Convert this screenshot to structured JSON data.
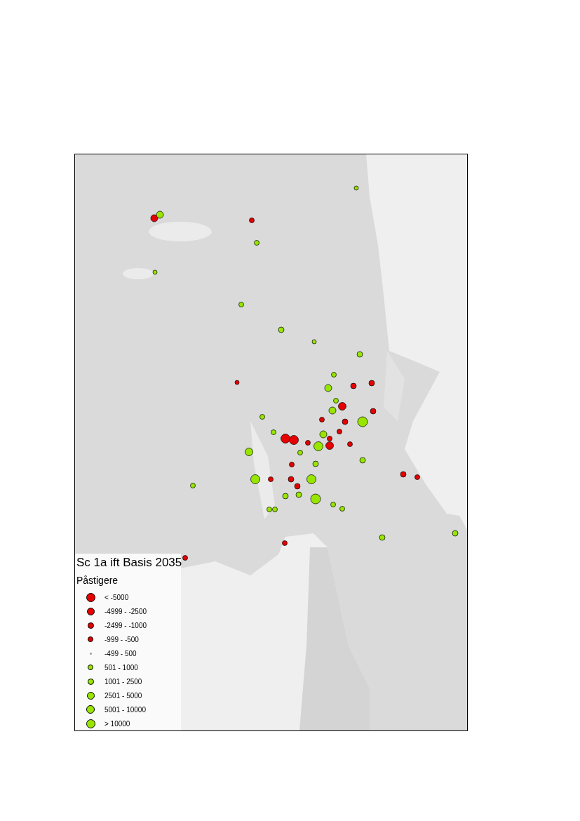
{
  "legend": {
    "title": "Sc 1a ift Basis 2035",
    "subtitle": "Påstigere",
    "items": [
      {
        "label": "< -5000",
        "color": "#e60000"
      },
      {
        "label": "-4999 - -2500",
        "color": "#e60000"
      },
      {
        "label": "-2499 - -1000",
        "color": "#e60000"
      },
      {
        "label": "-999 - -500",
        "color": "#e60000"
      },
      {
        "label": "-499 - 500",
        "color": "#9a9a9a"
      },
      {
        "label": "501 - 1000",
        "color": "#98e600"
      },
      {
        "label": "1001 - 2500",
        "color": "#98e600"
      },
      {
        "label": "2501 - 5000",
        "color": "#98e600"
      },
      {
        "label": "5001 - 10000",
        "color": "#98e600"
      },
      {
        "label": "> 10000",
        "color": "#98e600"
      }
    ]
  }
}
